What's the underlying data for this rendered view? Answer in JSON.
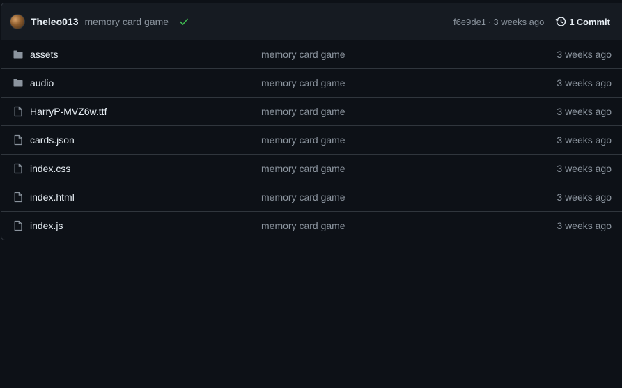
{
  "latest_commit": {
    "author": "Theleo013",
    "message": "memory card game",
    "status_icon": "check-icon",
    "status_color": "#3fb950",
    "sha": "f6e9de1",
    "separator": "·",
    "age": "3 weeks ago",
    "commit_count": "1",
    "commit_word": "Commit",
    "history_icon": "history-icon"
  },
  "files": [
    {
      "name": "assets",
      "type": "directory",
      "icon": "folder-icon",
      "message": "memory card game",
      "age": "3 weeks ago"
    },
    {
      "name": "audio",
      "type": "directory",
      "icon": "folder-icon",
      "message": "memory card game",
      "age": "3 weeks ago"
    },
    {
      "name": "HarryP-MVZ6w.ttf",
      "type": "file",
      "icon": "file-icon",
      "message": "memory card game",
      "age": "3 weeks ago"
    },
    {
      "name": "cards.json",
      "type": "file",
      "icon": "file-icon",
      "message": "memory card game",
      "age": "3 weeks ago"
    },
    {
      "name": "index.css",
      "type": "file",
      "icon": "file-icon",
      "message": "memory card game",
      "age": "3 weeks ago"
    },
    {
      "name": "index.html",
      "type": "file",
      "icon": "file-icon",
      "message": "memory card game",
      "age": "3 weeks ago"
    },
    {
      "name": "index.js",
      "type": "file",
      "icon": "file-icon",
      "message": "memory card game",
      "age": "3 weeks ago"
    }
  ],
  "colors": {
    "background": "#0d1117",
    "header_bg": "#161b22",
    "border": "#30363d",
    "text": "#e6edf3",
    "muted": "#8b949e",
    "folder": "#8b949e"
  }
}
